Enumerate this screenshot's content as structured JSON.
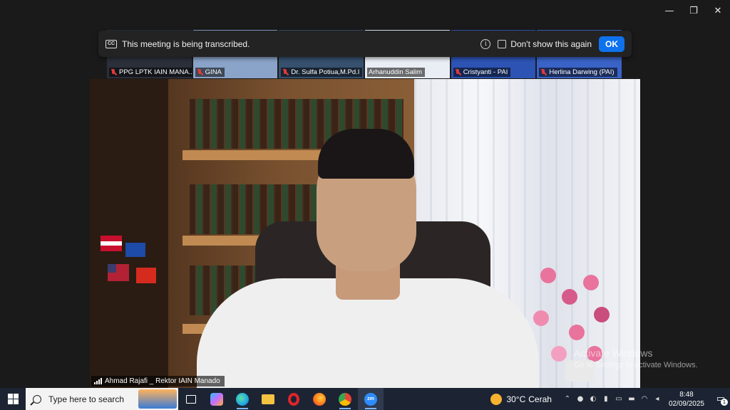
{
  "window_controls": {
    "minimize": "—",
    "restore": "❐",
    "close": "✕"
  },
  "banner": {
    "message": "This meeting is being transcribed.",
    "dont_show": "Don't show this again",
    "ok_label": "OK",
    "cc_icon_text": "CC"
  },
  "participants": [
    {
      "name": "PPG LPTK IAIN MANA...",
      "muted": true,
      "thumb_color": "#2a2f3a"
    },
    {
      "name": "GINA",
      "muted": true,
      "thumb_color": "#8aa3c8"
    },
    {
      "name": "Dr. Sulfa Potiua,M.Pd.I",
      "muted": true,
      "thumb_color": "#36506e"
    },
    {
      "name": "Arhanuddin Salim",
      "muted": false,
      "thumb_color": "#e9eef4"
    },
    {
      "name": "Cristyanti - PAI",
      "muted": true,
      "thumb_color": "#2d54b5"
    },
    {
      "name": "Herlina Darwing (PAI)",
      "muted": true,
      "thumb_color": "#3a63c8"
    }
  ],
  "main_video": {
    "speaker": "Ahmad Rajafi _ Rektor IAIN Manado"
  },
  "watermark": {
    "title": "Activate Windows",
    "subtitle": "Go to Settings to activate Windows."
  },
  "taskbar": {
    "search_placeholder": "Type here to search",
    "apps": [
      {
        "name": "task-view",
        "color": "#ffffff"
      },
      {
        "name": "copilot",
        "color": "#c86bff"
      },
      {
        "name": "edge",
        "color": "#1ea7e6"
      },
      {
        "name": "file-explorer",
        "color": "#f5c342"
      },
      {
        "name": "opera",
        "color": "#e0242b"
      },
      {
        "name": "firefox",
        "color": "#ff7a1a"
      },
      {
        "name": "chrome",
        "color": "#34a853"
      },
      {
        "name": "zoom",
        "color": "#2d8cff"
      }
    ],
    "weather": {
      "temp": "30°C",
      "condition": "Cerah"
    },
    "clock": {
      "time": "8:48",
      "date": "02/09/2025"
    },
    "notification_count": "1"
  }
}
